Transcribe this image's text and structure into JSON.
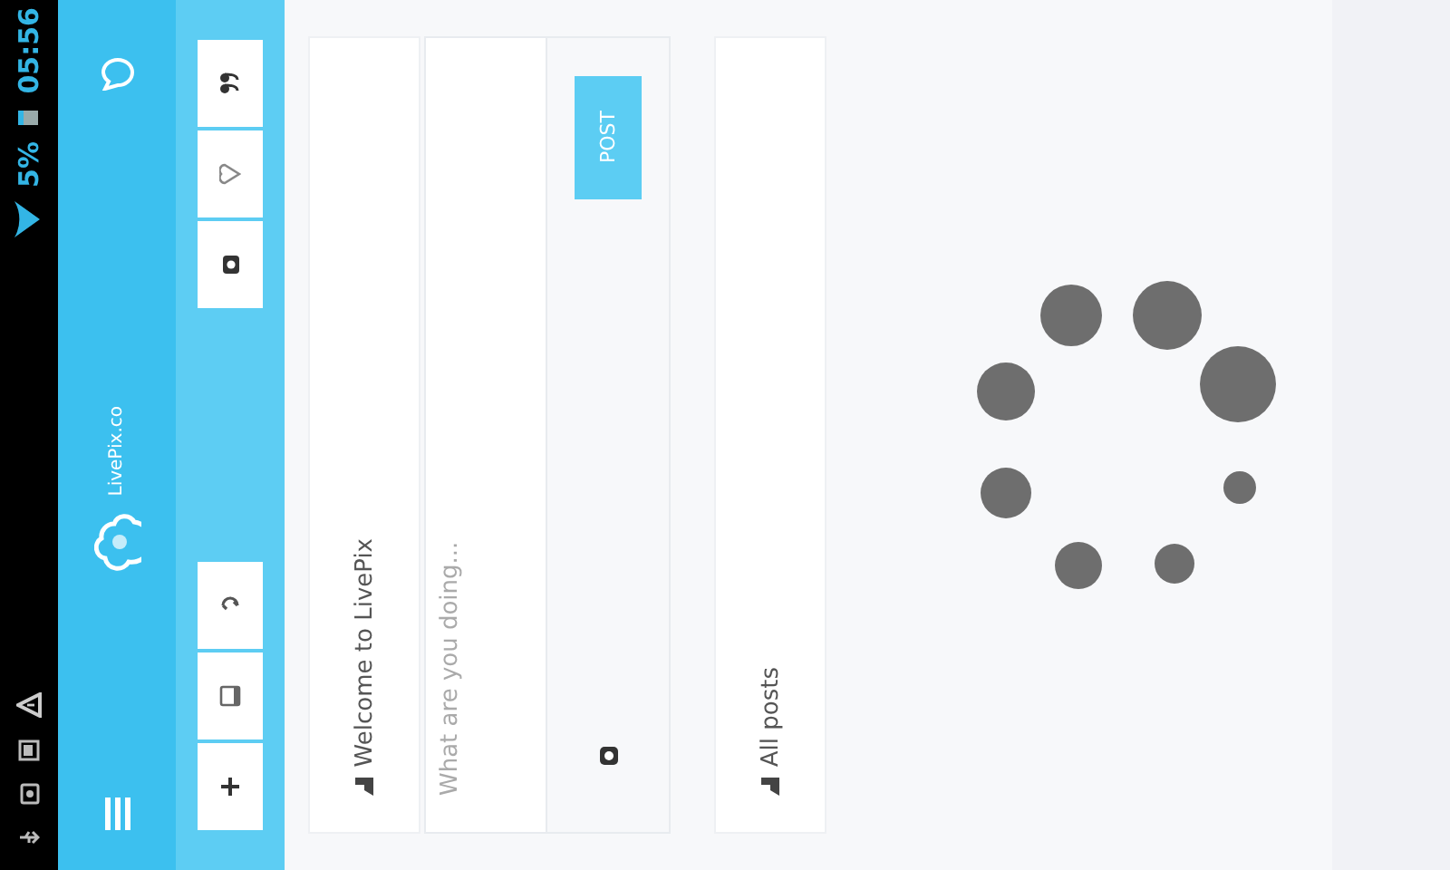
{
  "status_bar": {
    "time": "05:56",
    "battery": "5%"
  },
  "sidebar": {
    "logo_text": "LivePix.co"
  },
  "welcome_card": {
    "title": "Welcome to LivePix"
  },
  "composer": {
    "placeholder": "What are you doing...",
    "post_button": "POST"
  },
  "posts_card": {
    "title": "All posts"
  }
}
